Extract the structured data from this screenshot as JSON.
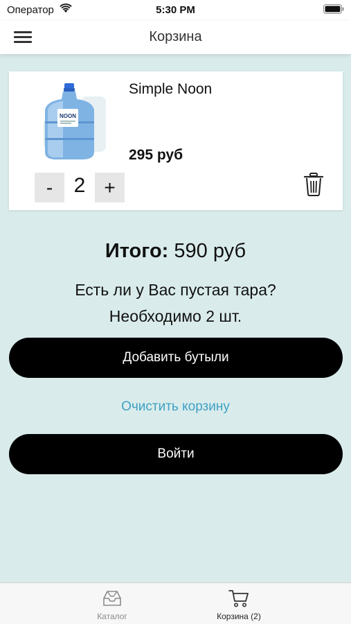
{
  "status_bar": {
    "carrier": "Оператор",
    "time": "5:30 PM"
  },
  "nav": {
    "title": "Корзина",
    "menu_icon": "hamburger-menu-icon"
  },
  "cart_items": [
    {
      "name": "Simple Noon",
      "price": "295 руб",
      "quantity": "2",
      "image_label": "NOON"
    }
  ],
  "quantity_controls": {
    "minus": "-",
    "plus": "+"
  },
  "summary": {
    "total_label": "Итого:",
    "total_value": "590 руб",
    "question": "Есть ли у Вас пустая тара?",
    "needed": "Необходимо 2 шт."
  },
  "actions": {
    "add_bottles": "Добавить бутыли",
    "clear_cart": "Очистить корзину",
    "login": "Войти"
  },
  "tabs": [
    {
      "label": "Каталог",
      "icon": "inbox-tray-icon"
    },
    {
      "label": "Корзина (2)",
      "icon": "shopping-cart-icon"
    }
  ],
  "colors": {
    "background": "#d9eceb",
    "primary_button": "#000000",
    "link": "#3fa0c4"
  }
}
